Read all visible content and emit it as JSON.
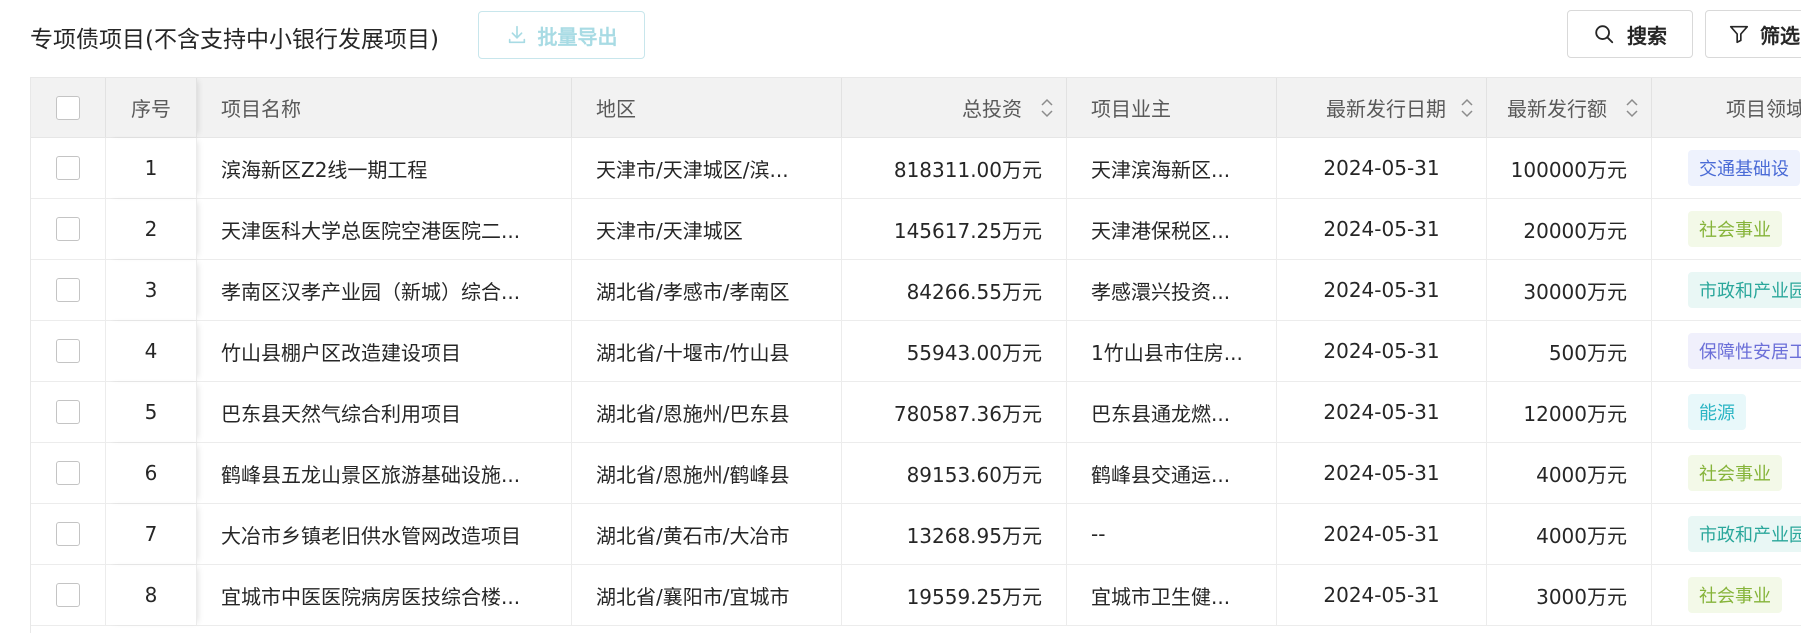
{
  "header": {
    "title": "专项债项目(不含支持中小银行发展项目)",
    "export_label": "批量导出",
    "search_label": "搜索",
    "filter_label": "筛选"
  },
  "table": {
    "columns": {
      "seq": "序号",
      "name": "项目名称",
      "region": "地区",
      "investment": "总投资",
      "owner": "项目业主",
      "issue_date": "最新发行日期",
      "issue_amount": "最新发行额",
      "field": "项目领域"
    },
    "rows": [
      {
        "seq": "1",
        "name": "滨海新区Z2线一期工程",
        "region": "天津市/天津城区/滨...",
        "investment": "818311.00万元",
        "owner": "天津滨海新区...",
        "issue_date": "2024-05-31",
        "issue_amount": "100000万元",
        "field": "交通基础设",
        "tag_color": "#4a6bd6",
        "tag_bg": "#eef2fd"
      },
      {
        "seq": "2",
        "name": "天津医科大学总医院空港医院二...",
        "region": "天津市/天津城区",
        "investment": "145617.25万元",
        "owner": "天津港保税区...",
        "issue_date": "2024-05-31",
        "issue_amount": "20000万元",
        "field": "社会事业",
        "tag_color": "#86b43a",
        "tag_bg": "#f3f9e8"
      },
      {
        "seq": "3",
        "name": "孝南区汉孝产业园（新城）综合...",
        "region": "湖北省/孝感市/孝南区",
        "investment": "84266.55万元",
        "owner": "孝感澴兴投资...",
        "issue_date": "2024-05-31",
        "issue_amount": "30000万元",
        "field": "市政和产业园区",
        "tag_color": "#2aa79b",
        "tag_bg": "#e9f7f5"
      },
      {
        "seq": "4",
        "name": "竹山县棚户区改造建设项目",
        "region": "湖北省/十堰市/竹山县",
        "investment": "55943.00万元",
        "owner": "1竹山县市住房...",
        "issue_date": "2024-05-31",
        "issue_amount": "500万元",
        "field": "保障性安居工",
        "tag_color": "#6b6fd8",
        "tag_bg": "#f0f0fc"
      },
      {
        "seq": "5",
        "name": "巴东县天然气综合利用项目",
        "region": "湖北省/恩施州/巴东县",
        "investment": "780587.36万元",
        "owner": "巴东县通龙燃...",
        "issue_date": "2024-05-31",
        "issue_amount": "12000万元",
        "field": "能源",
        "tag_color": "#2bb5c4",
        "tag_bg": "#e8f8fa"
      },
      {
        "seq": "6",
        "name": "鹤峰县五龙山景区旅游基础设施...",
        "region": "湖北省/恩施州/鹤峰县",
        "investment": "89153.60万元",
        "owner": "鹤峰县交通运...",
        "issue_date": "2024-05-31",
        "issue_amount": "4000万元",
        "field": "社会事业",
        "tag_color": "#86b43a",
        "tag_bg": "#f3f9e8"
      },
      {
        "seq": "7",
        "name": "大冶市乡镇老旧供水管网改造项目",
        "region": "湖北省/黄石市/大冶市",
        "investment": "13268.95万元",
        "owner": "--",
        "issue_date": "2024-05-31",
        "issue_amount": "4000万元",
        "field": "市政和产业园区",
        "tag_color": "#2aa79b",
        "tag_bg": "#e9f7f5"
      },
      {
        "seq": "8",
        "name": "宜城市中医医院病房医技综合楼...",
        "region": "湖北省/襄阳市/宜城市",
        "investment": "19559.25万元",
        "owner": "宜城市卫生健...",
        "issue_date": "2024-05-31",
        "issue_amount": "3000万元",
        "field": "社会事业",
        "tag_color": "#86b43a",
        "tag_bg": "#f3f9e8"
      }
    ]
  }
}
